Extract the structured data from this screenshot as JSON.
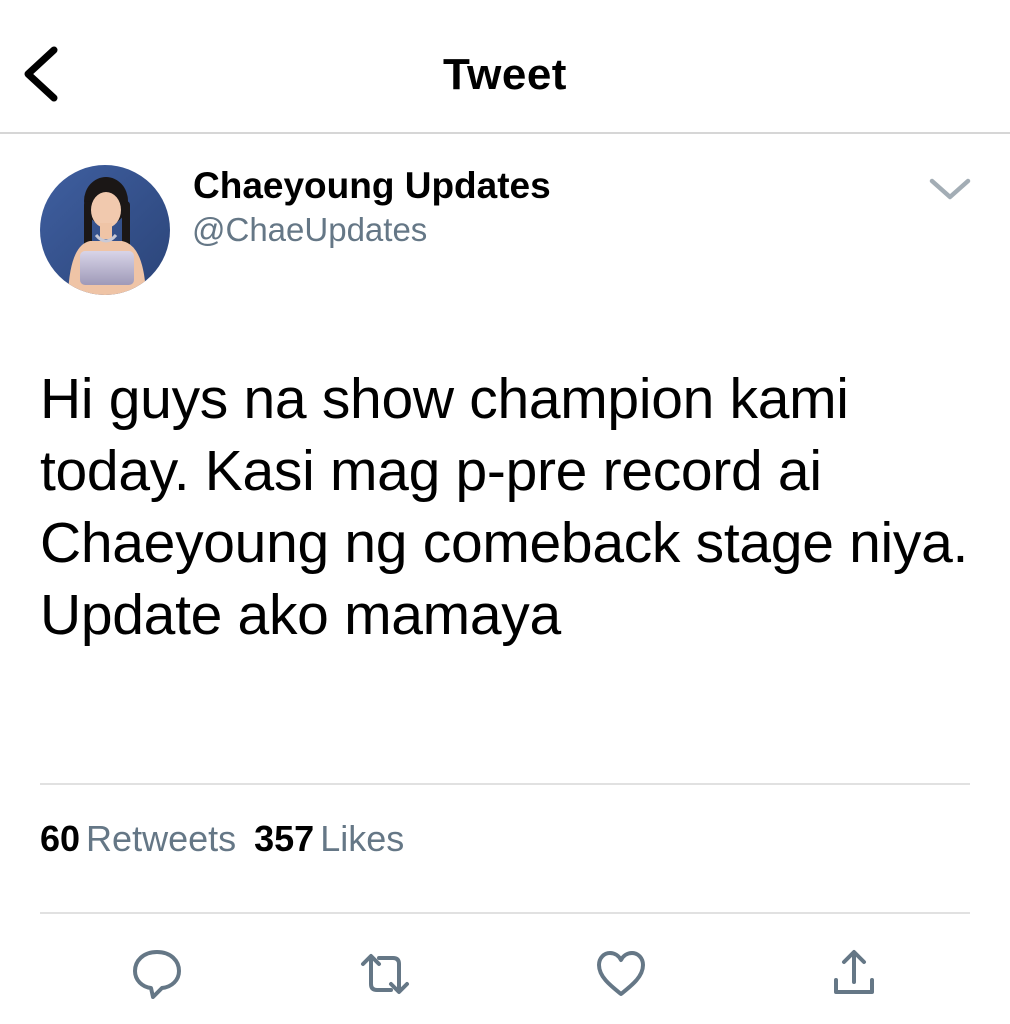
{
  "nav": {
    "title": "Tweet",
    "back_icon": "chevron-left-icon"
  },
  "author": {
    "display_name": "Chaeyoung Updates",
    "handle": "@ChaeUpdates",
    "avatar": "profile-photo",
    "menu_icon": "chevron-down-icon"
  },
  "tweet": {
    "text": "Hi guys na show champion kami today. Kasi mag p-pre record ai Chaeyoung ng comeback stage niya. Update ako mamaya"
  },
  "stats": {
    "retweets_count": "60",
    "retweets_label": "Retweets",
    "likes_count": "357",
    "likes_label": "Likes"
  },
  "actions": [
    "reply-icon",
    "retweet-icon",
    "like-icon",
    "share-icon"
  ],
  "colors": {
    "secondary_text": "#657786",
    "icon": "#657786",
    "divider": "#e1e1e1"
  }
}
